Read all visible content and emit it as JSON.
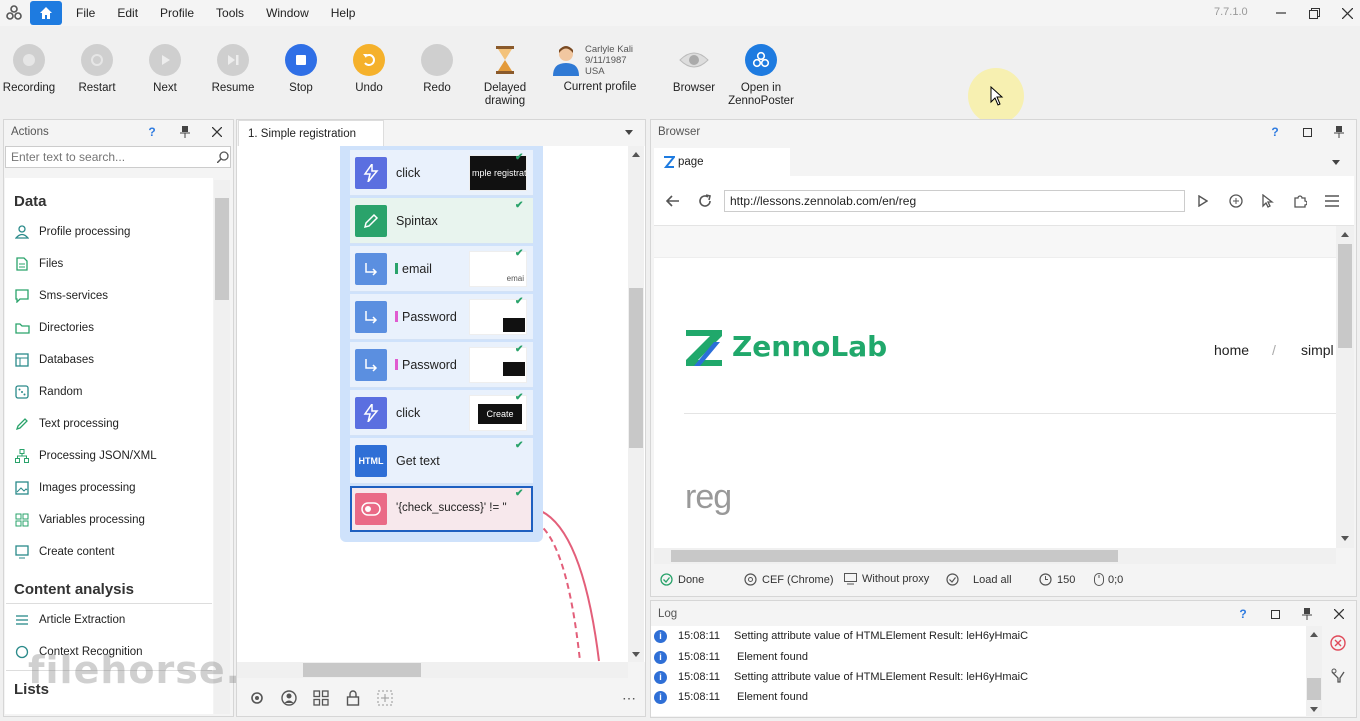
{
  "app": {
    "version": "7.7.1.0"
  },
  "menu": [
    "File",
    "Edit",
    "Profile",
    "Tools",
    "Window",
    "Help"
  ],
  "toolbar": {
    "recording": "Recording",
    "restart": "Restart",
    "next": "Next",
    "resume": "Resume",
    "stop": "Stop",
    "undo": "Undo",
    "redo": "Redo",
    "delayed1": "Delayed",
    "delayed2": "drawing",
    "current_profile": "Current profile",
    "profile_name": "Carlyle Kali",
    "profile_dob": "9/11/1987",
    "profile_country": "USA",
    "browser": "Browser",
    "open1": "Open in",
    "open2": "ZennoPoster"
  },
  "actions": {
    "title": "Actions",
    "search_placeholder": "Enter text to search...",
    "sections": {
      "data": "Data",
      "content": "Content analysis",
      "lists": "Lists"
    },
    "data_items": [
      "Profile processing",
      "Files",
      "Sms-services",
      "Directories",
      "Databases",
      "Random",
      "Text processing",
      "Processing JSON/XML",
      "Images processing",
      "Variables processing",
      "Create content"
    ],
    "content_items": [
      "Article Extraction",
      "Context Recognition"
    ]
  },
  "project": {
    "tab": "1. Simple registration",
    "actions": [
      {
        "name": "click",
        "preview": "mple registrat"
      },
      {
        "name": "Spintax",
        "preview": ""
      },
      {
        "name": "email",
        "preview": "emai"
      },
      {
        "name": "Password",
        "preview": ""
      },
      {
        "name": "Password",
        "preview": ""
      },
      {
        "name": "click",
        "preview": "Create"
      },
      {
        "name": "Get text",
        "preview": ""
      },
      {
        "name": "'{check_success}' != ''",
        "preview": ""
      }
    ]
  },
  "browser": {
    "title": "Browser",
    "tab": "page",
    "url": "http://lessons.zennolab.com/en/reg",
    "logo_text": "ZennoLab",
    "nav_home": "home",
    "nav_sep": "/",
    "nav_simple": "simpl",
    "heading": "reg",
    "status": {
      "done": "Done",
      "engine": "CEF (Chrome)",
      "proxy": "Without proxy",
      "load": "Load all",
      "timeout": "150",
      "clicks": "0;0"
    }
  },
  "log": {
    "title": "Log",
    "rows": [
      {
        "time": "15:08:11",
        "msg": "Setting attribute value of HTMLElement  Result: leH6yHmaiC"
      },
      {
        "time": "15:08:11",
        "msg": "Element found"
      },
      {
        "time": "15:08:11",
        "msg": "Setting attribute value of HTMLElement  Result: leH6yHmaiC"
      },
      {
        "time": "15:08:11",
        "msg": "Element found"
      }
    ]
  },
  "watermark": "filehorse.com",
  "colors": {
    "accent": "#1e7be0",
    "stop": "#2f6fe6",
    "undo": "#f5b12b",
    "group": "#cfe2fb",
    "logo_green": "#20a86b",
    "logo_blue": "#2b6fd8"
  }
}
